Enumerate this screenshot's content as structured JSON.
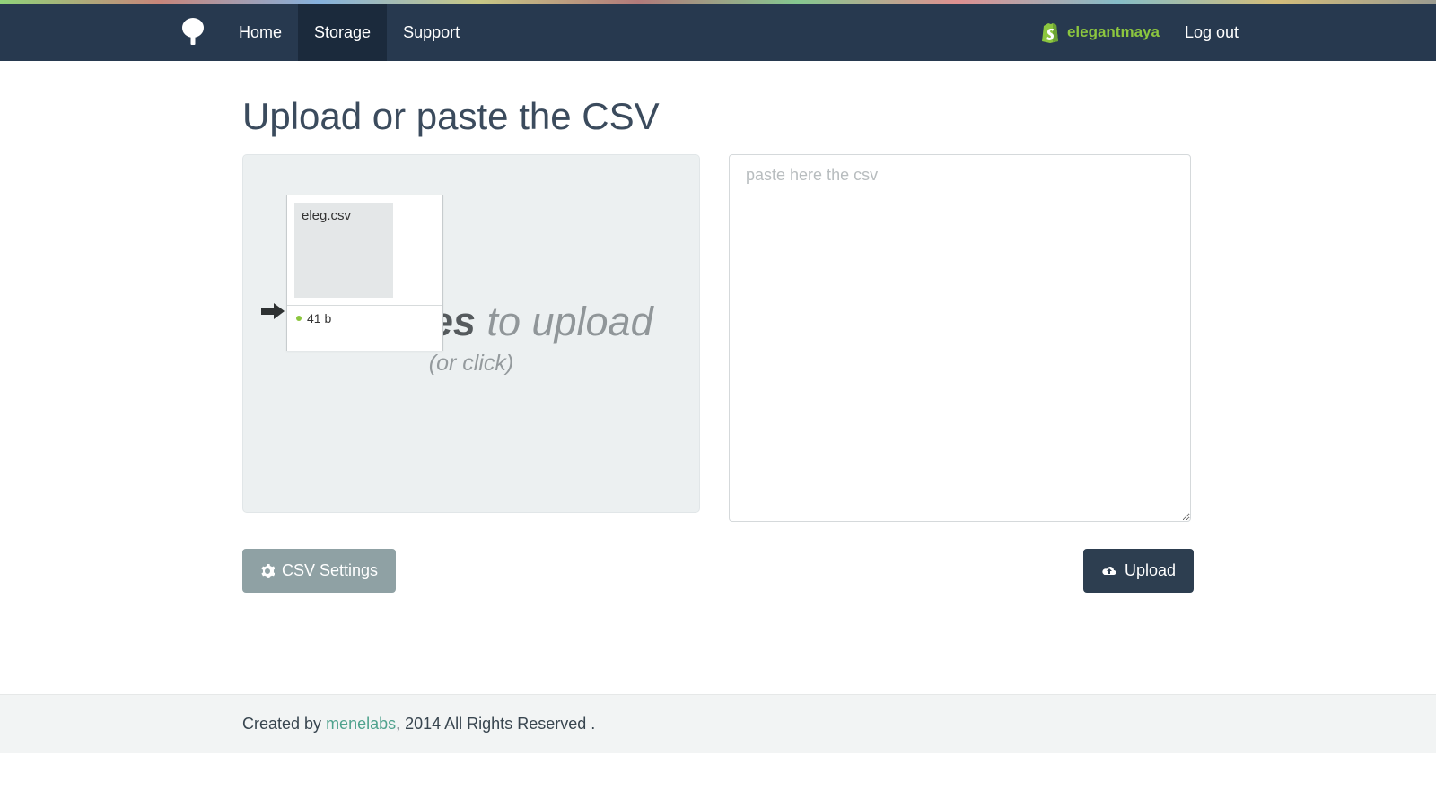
{
  "nav": {
    "items": [
      "Home",
      "Storage",
      "Support"
    ],
    "active_index": 1,
    "shop_name": "elegantmaya",
    "logout": "Log out"
  },
  "page": {
    "title": "Upload or paste the CSV"
  },
  "dropzone": {
    "line1_bold": "Drop files",
    "line1_rest": " to upload",
    "line2": "(or click)",
    "file": {
      "name": "eleg.csv",
      "size": "41 b"
    }
  },
  "textarea": {
    "placeholder": "paste here the csv"
  },
  "buttons": {
    "settings": "CSV Settings",
    "upload": "Upload"
  },
  "footer": {
    "prefix": "Created by ",
    "brand": "menelabs",
    "suffix": ", 2014 All Rights Reserved ."
  }
}
